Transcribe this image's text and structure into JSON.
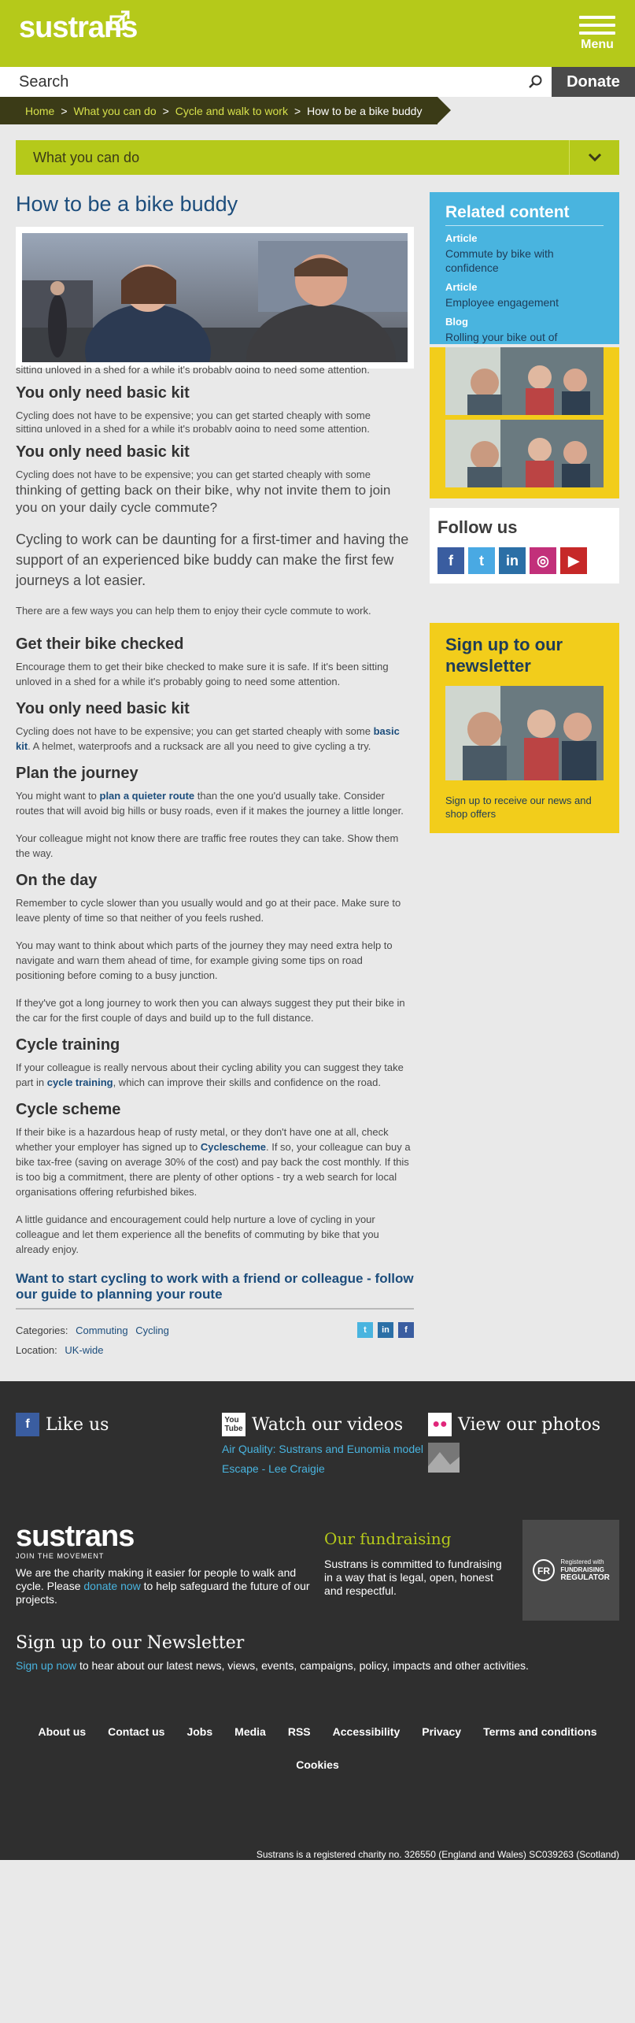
{
  "header": {
    "logo": "sustrans",
    "menu_label": "Menu",
    "search_placeholder": "Search",
    "donate_label": "Donate"
  },
  "breadcrumb": [
    "Home",
    "What you can do",
    "Cycle and walk to work",
    "How to be a bike buddy"
  ],
  "section_dropdown": {
    "label": "What you can do",
    "icon": "chevron-down-icon"
  },
  "article": {
    "title": "How to be a bike buddy",
    "ghost_line_1": "sitting unloved in a shed for a while it's probably going to need some attention.",
    "ghost_heading_1": "You only need basic kit",
    "ghost_body_1a": "Cycling does not have to be expensive; you can get started cheaply with some",
    "ghost_body_1b": "sitting unloved in a shed for a while it's probably going to need some attention.",
    "ghost_heading_2": "You only need basic kit",
    "ghost_body_2a": "Cycling does not have to be expensive; you can get started cheaply with some",
    "intro_tail": "thinking of getting back on their bike, why not invite them to join you on your daily cycle commute?",
    "lead": "Cycling to work can be daunting for a first-timer and having the support of an experienced bike buddy can make the first few journeys a lot easier.",
    "ways": "There are a few ways you can help them to enjoy their cycle commute to work.",
    "h_checked": "Get their bike checked",
    "p_checked": "Encourage them to get their bike checked to make sure it is safe. If it's been sitting unloved in a shed for a while it's probably going to need some attention.",
    "h_kit": "You only need basic kit",
    "p_kit_1": "Cycling does not have to be expensive; you can get started cheaply with some",
    "p_kit_link": "basic kit",
    "p_kit_2": ". A helmet, waterproofs and a rucksack are all you need to give cycling a try.",
    "h_plan": "Plan the journey",
    "p_plan_1": "You might want to",
    "p_plan_link": "plan a quieter route",
    "p_plan_2": "than the one you'd usually take. Consider routes that will avoid big hills or busy roads, even if it makes the journey a little longer.",
    "p_plan_3": "Your colleague might not know there are traffic free routes they can take. Show them the way.",
    "h_day": "On the day",
    "p_day_1": "Remember to cycle slower than you usually would and go at their pace. Make sure to leave plenty of time so that neither of you feels rushed.",
    "p_day_2": "You may want to think about which parts of the journey they may need extra help to navigate and warn them ahead of time, for example giving some tips on road positioning before coming to a busy junction.",
    "p_day_3": "If they've got a long journey to work then you can always suggest they put their bike in the car for the first couple of days and build up to the full distance.",
    "h_training": "Cycle training",
    "p_training_1": "If your colleague is really nervous about their cycling ability you can suggest they take part in",
    "p_training_link": "cycle training",
    "p_training_2": ", which can improve their skills and confidence on the road.",
    "h_scheme": "Cycle scheme",
    "p_scheme_1": "If their bike is a hazardous heap of rusty metal, or they don't have one at all, check whether your employer has signed up to",
    "p_scheme_link": "Cyclescheme",
    "p_scheme_2": ". If so, your colleague can buy a bike tax-free (saving on average 30% of the cost) and pay back the cost monthly. If this is too big a commitment, there are plenty of other options - try a web search for local organisations offering refurbished bikes.",
    "p_closing": "A little guidance and encouragement could help nurture a love of cycling in your colleague and let them experience all the benefits of commuting by bike that you already enjoy.",
    "cta": "Want to start cycling to work with a friend or colleague - follow our guide to planning your route",
    "categories_label": "Categories:",
    "categories": [
      "Commuting",
      "Cycling"
    ],
    "location_label": "Location:",
    "location": "UK-wide"
  },
  "sidebar": {
    "related_title": "Related content",
    "related": [
      {
        "kind": "Article",
        "title": "Commute by bike with confidence"
      },
      {
        "kind": "Article",
        "title": "Employee engagement"
      },
      {
        "kind": "Blog",
        "title": "Rolling your bike out of"
      }
    ],
    "follow_title": "Follow us",
    "newsletter_title": "Sign up to our newsletter",
    "newsletter_text": "Sign up to receive our news and shop offers"
  },
  "footer": {
    "like_us": "Like us",
    "videos": "Watch our videos",
    "video_links": [
      "Air Quality: Sustrans and Eunomia model",
      "Escape - Lee Craigie"
    ],
    "photos": "View our photos",
    "logo": "sustrans",
    "logo_tagline": "JOIN THE MOVEMENT",
    "about_1": "We are the charity making it easier for people to walk and cycle. Please",
    "about_link": "donate now",
    "about_2": "to help safeguard the future of our projects.",
    "fund_title": "Our fundraising",
    "fund_text": "Sustrans is committed to fundraising in a way that is legal, open, honest and respectful.",
    "fr_small": "Registered with",
    "fr_mid": "FUNDRAISING",
    "fr_big": "REGULATOR",
    "news_title": "Sign up to our Newsletter",
    "news_link": "Sign up now",
    "news_text": "to hear about our latest news, views, events, campaigns, policy, impacts and other activities.",
    "links": [
      "About us",
      "Contact us",
      "Jobs",
      "Media",
      "RSS",
      "Accessibility",
      "Privacy",
      "Terms and conditions"
    ],
    "cookies": "Cookies",
    "legal": "Sustrans is a registered charity no. 326550 (England and Wales) SC039263 (Scotland)"
  },
  "colors": {
    "brand_green": "#b5c91a",
    "dark_olive": "#3b3b17",
    "link_blue": "#1c4d7c",
    "sky_blue": "#49b4df",
    "yellow": "#f2cd1b",
    "footer_bg": "#2f2f2f"
  }
}
